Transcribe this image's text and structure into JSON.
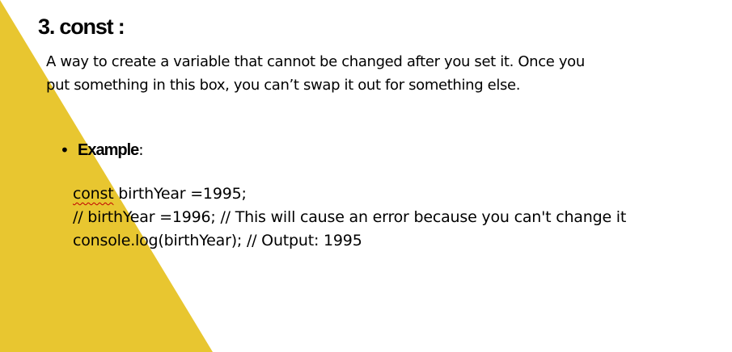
{
  "colors": {
    "accent_yellow": "#e8c630",
    "background": "#ffffff",
    "text": "#000000",
    "spellcheck_squiggle": "#c00000"
  },
  "heading": "3. const :",
  "definition": {
    "line1": "A way to create a variable that cannot be changed after you set it. Once you",
    "line2": "put something in this box, you can’t swap it out for something else."
  },
  "example": {
    "bullet": "•",
    "label": "Example",
    "colon": ":"
  },
  "code": {
    "line1_keyword": "const",
    "line1_rest": " birthYear =1995;",
    "line2": "// birthYear =1996; // This will cause an error because you can't change it",
    "line3": "console.log(birthYear); // Output: 1995"
  }
}
